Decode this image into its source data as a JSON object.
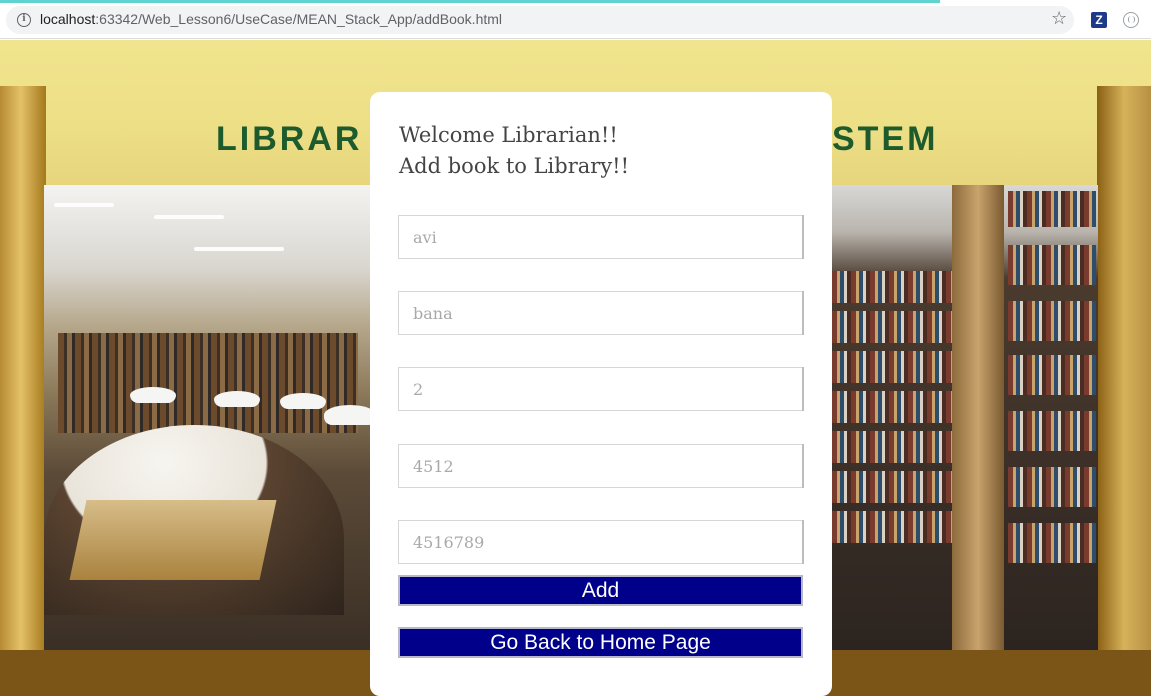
{
  "browser": {
    "url_host": "localhost",
    "url_path": ":63342/Web_Lesson6/UseCase/MEAN_Stack_App/addBook.html",
    "icons": [
      "info-icon",
      "star-icon",
      "z-extension-icon",
      "extension-circle-icon"
    ]
  },
  "background": {
    "sign_left": "LIBRAR",
    "sign_right": "STEM"
  },
  "form": {
    "heading_line1": "Welcome Librarian!!",
    "heading_line2": "Add book to Library!!",
    "fields": [
      {
        "value": "avi"
      },
      {
        "value": "bana"
      },
      {
        "value": "2"
      },
      {
        "value": "4512"
      },
      {
        "value": "4516789"
      }
    ],
    "add_label": "Add",
    "back_label": "Go Back to Home Page"
  },
  "colors": {
    "button_bg": "#00008b",
    "heading_text": "#444444",
    "input_text": "#a9a9a9"
  }
}
